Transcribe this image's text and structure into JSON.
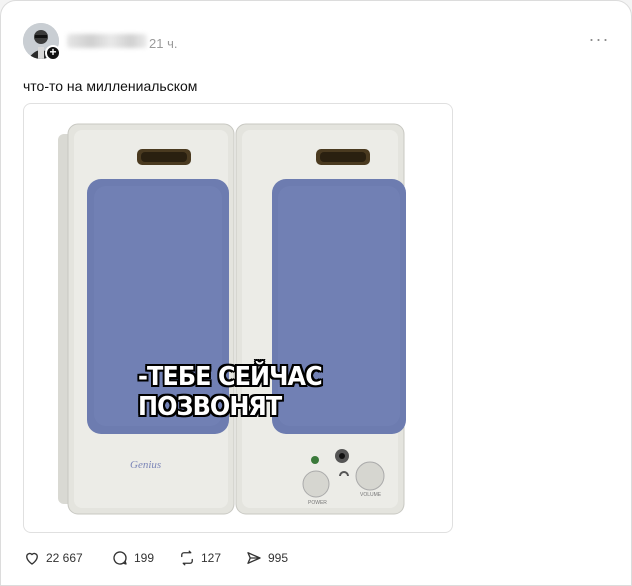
{
  "post": {
    "author_name": "·····",
    "time": "21 ч.",
    "more_label": "···",
    "text": "что-то на миллениальском",
    "image": {
      "caption": "-ТЕБЕ СЕЙЧАС ПОЗВОНЯТ",
      "brand": "Genius",
      "label_power": "POWER",
      "label_volume": "VOLUME"
    }
  },
  "actions": {
    "likes": "22 667",
    "replies": "199",
    "reposts": "127",
    "shares": "995"
  },
  "colors": {
    "accent_text": "#111111",
    "muted_text": "#9a9a9a",
    "speaker_body": "#e4e4de",
    "speaker_grille": "#6d7cb0"
  }
}
